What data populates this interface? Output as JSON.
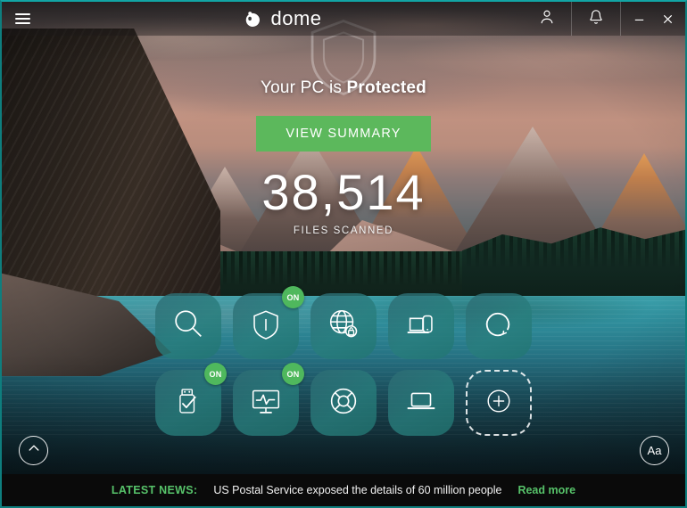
{
  "window": {
    "titlebar": {
      "menu_icon": "hamburger-icon",
      "brand_name": "dome",
      "brand_sup": "panda",
      "account_icon": "user-icon",
      "notifications_icon": "bell-icon",
      "minimize_label": "–",
      "close_label": "✕"
    }
  },
  "hero": {
    "shield_icon": "shield-icon",
    "status_prefix": "Your PC is ",
    "status_state": "Protected",
    "summary_button": "VIEW SUMMARY",
    "counter_value": "38,514",
    "counter_label": "FILES SCANNED"
  },
  "tiles": {
    "rows": [
      [
        {
          "name": "scan",
          "icon": "magnifier-icon",
          "badge": null
        },
        {
          "name": "antivirus",
          "icon": "shield-icon",
          "badge": "ON"
        },
        {
          "name": "vpn",
          "icon": "globe-lock-icon",
          "badge": null
        },
        {
          "name": "my-devices",
          "icon": "laptop-phone-icon",
          "badge": null
        },
        {
          "name": "update",
          "icon": "circular-arrow-icon",
          "badge": null
        }
      ],
      [
        {
          "name": "usb-protection",
          "icon": "usb-check-icon",
          "badge": "ON"
        },
        {
          "name": "process-monitor",
          "icon": "monitor-pulse-icon",
          "badge": "ON"
        },
        {
          "name": "rescue-kit",
          "icon": "life-ring-icon",
          "badge": null
        },
        {
          "name": "pc-cleanup",
          "icon": "laptop-icon",
          "badge": null
        },
        {
          "name": "add-tile",
          "icon": "plus-circle-icon",
          "badge": null
        }
      ]
    ]
  },
  "corner": {
    "expand_icon": "chevron-up-icon",
    "text_size_label": "Aa"
  },
  "news": {
    "label": "LATEST NEWS:",
    "headline": "US Postal Service exposed the details of 60 million people",
    "link": "Read more"
  },
  "colors": {
    "accent_green": "#5cb85c",
    "badge_green": "#4fb85d",
    "tile_teal": "#2a7c7a",
    "news_bg": "#0a0a0a",
    "frame_teal": "#12a5a5"
  }
}
